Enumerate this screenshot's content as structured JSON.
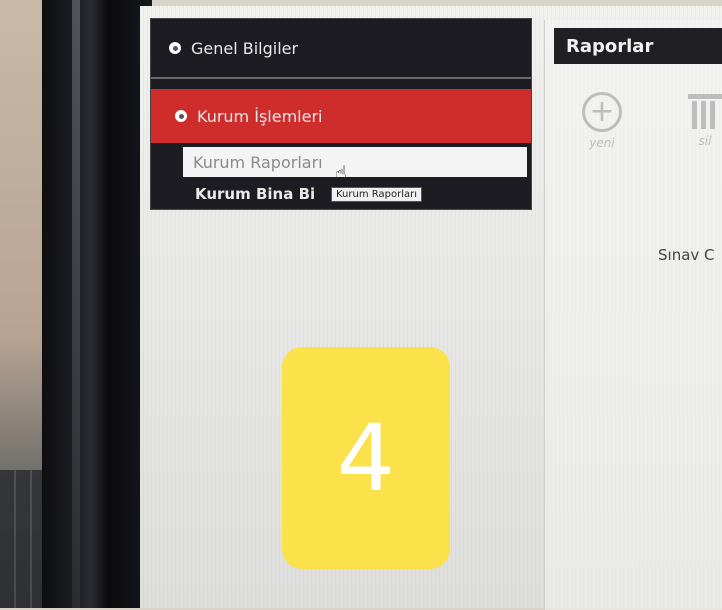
{
  "menu": {
    "general": "Genel Bilgiler",
    "institution_ops": "Kurum İşlemleri",
    "institution_reports": "Kurum Raporları",
    "institution_building": "Kurum Bina Bi",
    "tooltip": "Kurum Raporları"
  },
  "reports": {
    "title": "Raporlar",
    "new_label": "yeni",
    "delete_label": "sil",
    "exam_text": "Sınav C"
  },
  "overlay": {
    "number": "4"
  },
  "colors": {
    "active_menu": "#cf2c2c",
    "badge": "#fbe14a",
    "header": "#202024"
  }
}
